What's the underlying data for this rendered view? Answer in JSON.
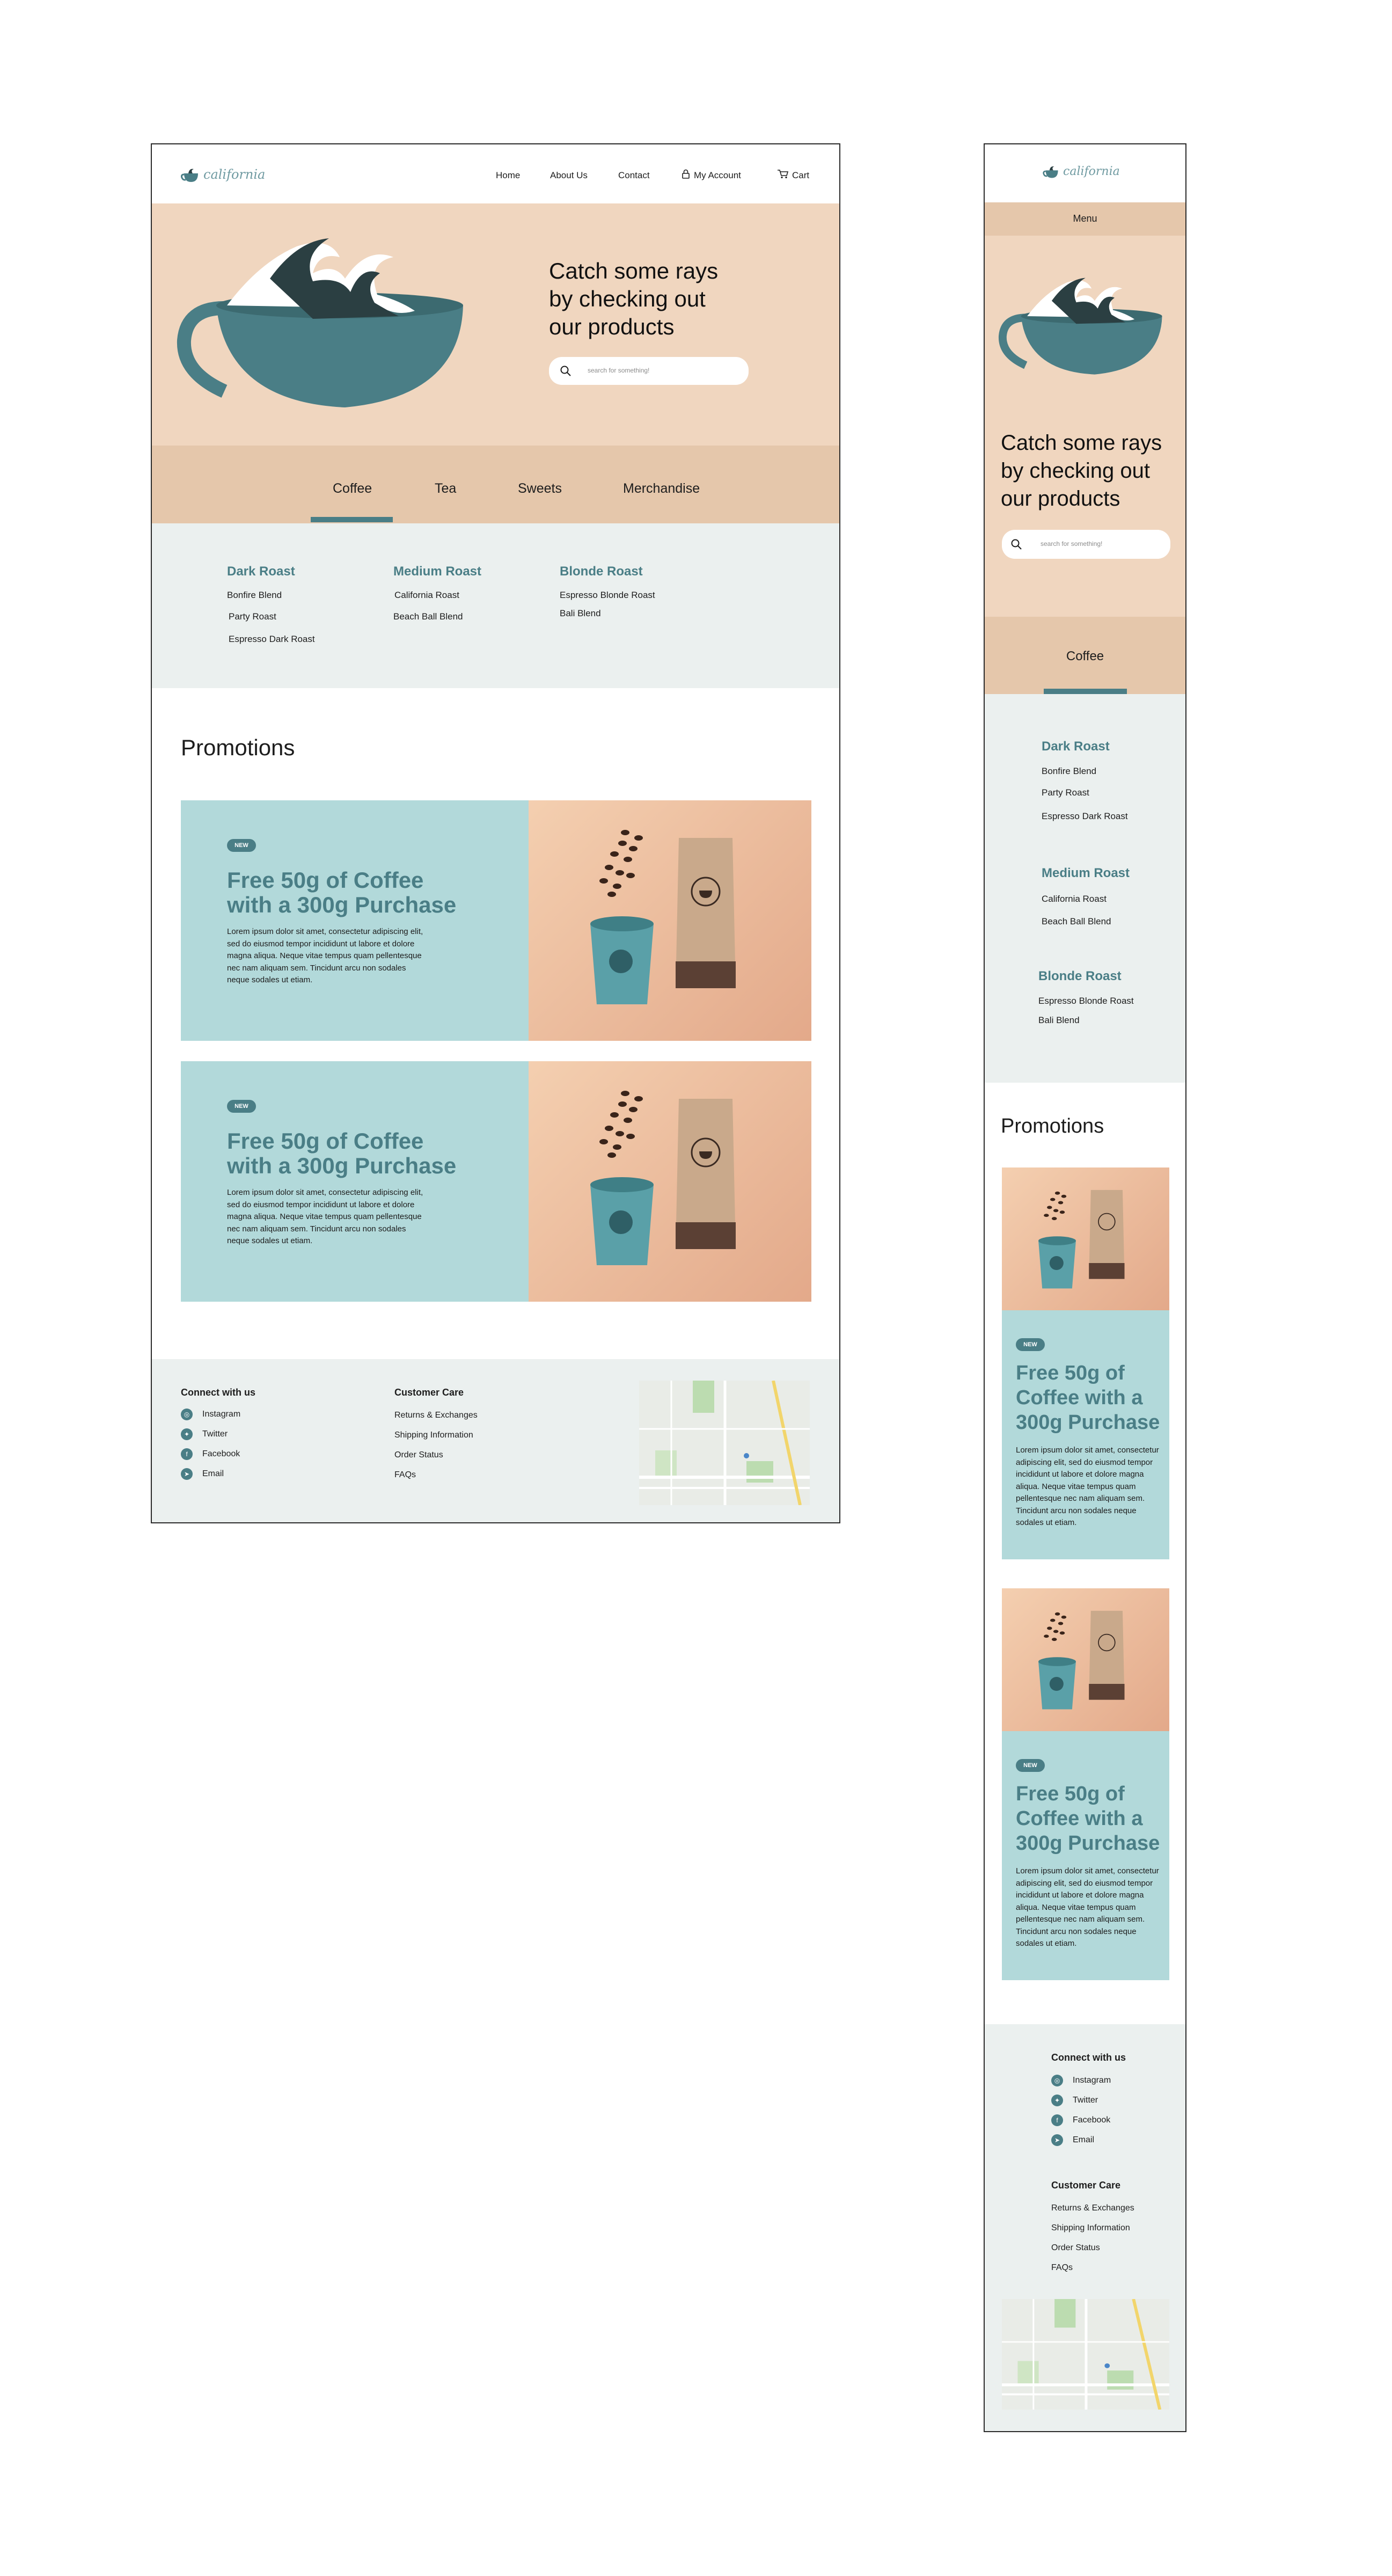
{
  "brand": {
    "logo_text": "california"
  },
  "nav": {
    "home": "Home",
    "about": "About Us",
    "contact": "Contact",
    "account": "My Account",
    "cart": "Cart"
  },
  "mobile_menu": {
    "label": "Menu"
  },
  "hero": {
    "headline_line1": "Catch some rays",
    "headline_line2": "by checking out",
    "headline_line3": "our products",
    "search_placeholder": "search for something!"
  },
  "tabs": [
    {
      "label": "Coffee",
      "active": true
    },
    {
      "label": "Tea",
      "active": false
    },
    {
      "label": "Sweets",
      "active": false
    },
    {
      "label": "Merchandise",
      "active": false
    }
  ],
  "roasts": [
    {
      "title": "Dark Roast",
      "items": [
        "Bonfire Blend",
        "Party Roast",
        "Espresso Dark Roast"
      ]
    },
    {
      "title": "Medium Roast",
      "items": [
        "California Roast",
        "Beach Ball Blend"
      ]
    },
    {
      "title": "Blonde Roast",
      "items": [
        "Espresso Blonde Roast",
        "Bali Blend"
      ]
    }
  ],
  "promotions": {
    "heading": "Promotions",
    "cards": [
      {
        "badge": "NEW",
        "title_desktop_1": "Free 50g of Coffee",
        "title_desktop_2": "with a 300g Purchase",
        "title_mobile_1": "Free 50g of",
        "title_mobile_2": "Coffee with a",
        "title_mobile_3": "300g Purchase",
        "body": "Lorem ipsum dolor sit amet, consectetur adipiscing elit, sed do eiusmod tempor incididunt ut labore et dolore magna aliqua. Neque vitae tempus quam pellentesque nec nam aliquam sem. Tincidunt arcu non sodales neque sodales ut etiam."
      },
      {
        "badge": "NEW",
        "title_desktop_1": "Free 50g of Coffee",
        "title_desktop_2": "with a 300g Purchase",
        "title_mobile_1": "Free 50g of",
        "title_mobile_2": "Coffee with a",
        "title_mobile_3": "300g Purchase",
        "body": "Lorem ipsum dolor sit amet, consectetur adipiscing elit, sed do eiusmod tempor incididunt ut labore et dolore magna aliqua. Neque vitae tempus quam pellentesque nec nam aliquam sem. Tincidunt arcu non sodales neque sodales ut etiam."
      }
    ]
  },
  "footer": {
    "connect_heading": "Connect with us",
    "social": [
      "Instagram",
      "Twitter",
      "Facebook",
      "Email"
    ],
    "care_heading": "Customer Care",
    "care": [
      "Returns & Exchanges",
      "Shipping Information",
      "Order Status",
      "FAQs"
    ]
  },
  "colors": {
    "accent": "#4a7e86",
    "hero_bg": "#f0d6bf",
    "tabs_bg": "#e5c7ab",
    "menu_bg": "#ebf0ef",
    "promo_bg": "#b2d9da"
  }
}
